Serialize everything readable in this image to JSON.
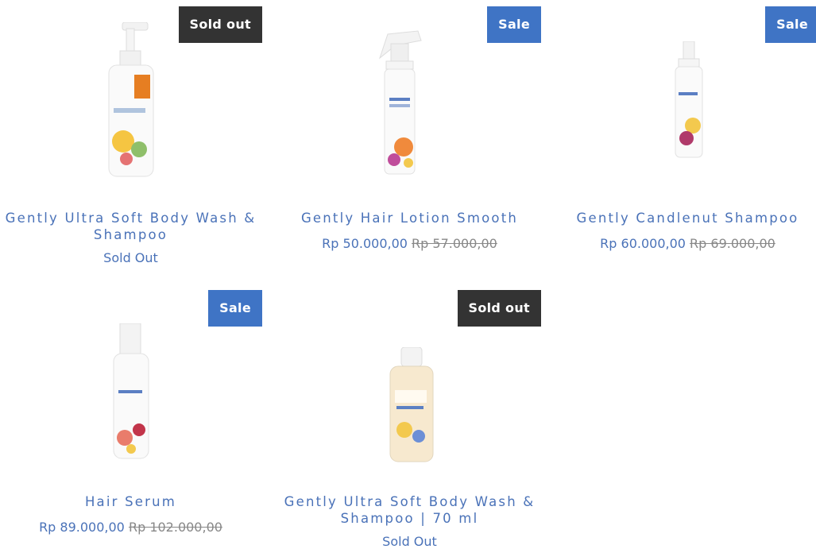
{
  "products": [
    {
      "title": "Gently Ultra Soft Body Wash & Shampoo",
      "badge": "Sold out",
      "status": "Sold Out"
    },
    {
      "title": "Gently Hair Lotion Smooth",
      "badge": "Sale",
      "price": "Rp 50.000,00",
      "old_price": "Rp 57.000,00"
    },
    {
      "title": "Gently Candlenut Shampoo",
      "badge": "Sale",
      "price": "Rp 60.000,00",
      "old_price": "Rp 69.000,00"
    },
    {
      "title": "Hair Serum",
      "badge": "Sale",
      "price": "Rp 89.000,00",
      "old_price": "Rp 102.000,00"
    },
    {
      "title": "Gently Ultra Soft Body Wash & Shampoo | 70 ml",
      "badge": "Sold out",
      "status": "Sold Out"
    }
  ],
  "colors": {
    "sale_badge": "#3f74c5",
    "soldout_badge": "#333333",
    "title": "#4a72b8"
  }
}
